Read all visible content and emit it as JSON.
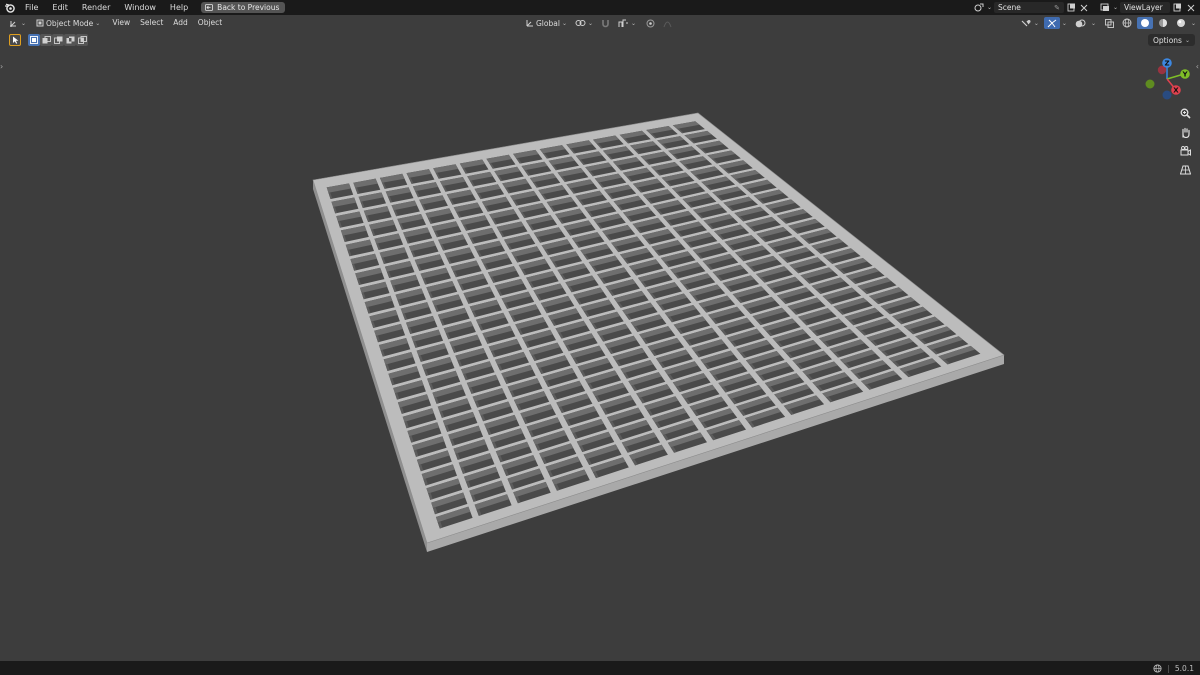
{
  "topbar": {
    "menu": [
      {
        "name": "menu-file",
        "label": "File"
      },
      {
        "name": "menu-edit",
        "label": "Edit"
      },
      {
        "name": "menu-render",
        "label": "Render"
      },
      {
        "name": "menu-window",
        "label": "Window"
      },
      {
        "name": "menu-help",
        "label": "Help"
      }
    ],
    "back_label": "Back to Previous",
    "scene_name": "Scene",
    "view_layer": "ViewLayer"
  },
  "header": {
    "mode": "Object Mode",
    "menus": [
      {
        "name": "menu-view",
        "label": "View"
      },
      {
        "name": "menu-select",
        "label": "Select"
      },
      {
        "name": "menu-add",
        "label": "Add"
      },
      {
        "name": "menu-object",
        "label": "Object"
      }
    ],
    "transform_orientation": "Global"
  },
  "toolrow": {
    "options_label": "Options"
  },
  "gizmo": {
    "axis_x": "X",
    "axis_y": "Y",
    "axis_z": "Z",
    "colors": {
      "x": "#e0414f",
      "y": "#7fbf27",
      "z": "#3d88e2"
    }
  },
  "statusbar": {
    "version": "5.0.1"
  },
  "grating": {
    "rows": 24,
    "cols": 14,
    "colors": {
      "top": "#bcbcbc",
      "hole": "#4a4a4a",
      "wall": "#6e6e6e",
      "edge": "#8e8e8e"
    }
  }
}
